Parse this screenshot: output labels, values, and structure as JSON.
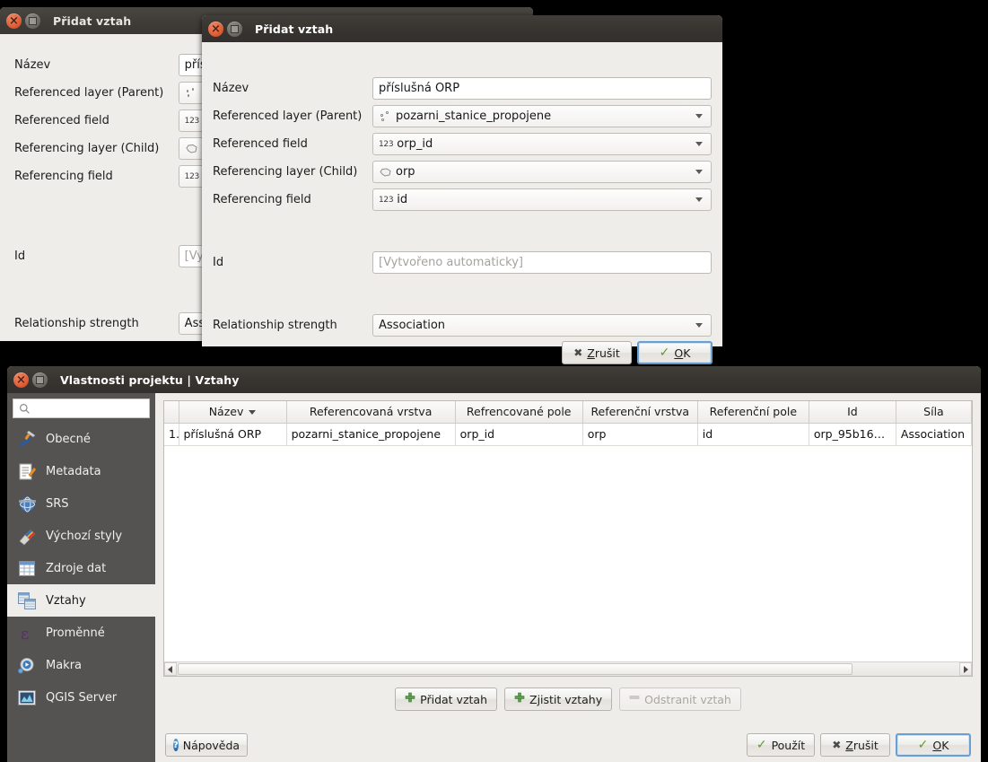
{
  "dialog_back": {
    "title": "Přidat vztah",
    "labels": {
      "name": "Název",
      "referenced_layer": "Referenced layer (Parent)",
      "referenced_field": "Referenced field",
      "referencing_layer": "Referencing layer (Child)",
      "referencing_field": "Referencing field",
      "id": "Id",
      "strength": "Relationship strength"
    },
    "values": {
      "name": "přís",
      "referenced_field_icon": "123",
      "referencing_field_icon": "123",
      "id_placeholder": "[Vy",
      "strength": "Ass"
    }
  },
  "dialog_front": {
    "title": "Přidat vztah",
    "labels": {
      "name": "Název",
      "referenced_layer": "Referenced layer (Parent)",
      "referenced_field": "Referenced field",
      "referencing_layer": "Referencing layer (Child)",
      "referencing_field": "Referencing field",
      "id": "Id",
      "strength": "Relationship strength"
    },
    "values": {
      "name": "příslušná ORP",
      "referenced_layer": "pozarni_stanice_propojene",
      "referenced_field": "orp_id",
      "referencing_layer": "orp",
      "referencing_field": "id",
      "id_placeholder": "[Vytvořeno automaticky]",
      "strength": "Association"
    },
    "field_icon_label": "123",
    "buttons": {
      "cancel": "Zrušit",
      "ok": "OK"
    }
  },
  "properties": {
    "title": "Vlastnosti projektu | Vztahy",
    "search_placeholder": "",
    "sidebar": [
      {
        "label": "Obecné",
        "icon": "hammer-wrench-icon",
        "active": false
      },
      {
        "label": "Metadata",
        "icon": "document-pencil-icon",
        "active": false
      },
      {
        "label": "SRS",
        "icon": "globe-icon",
        "active": false
      },
      {
        "label": "Výchozí styly",
        "icon": "paintbrush-icon",
        "active": false
      },
      {
        "label": "Zdroje dat",
        "icon": "table-icon",
        "active": false
      },
      {
        "label": "Vztahy",
        "icon": "relations-icon",
        "active": true
      },
      {
        "label": "Proměnné",
        "icon": "epsilon-icon",
        "active": false
      },
      {
        "label": "Makra",
        "icon": "gear-play-icon",
        "active": false
      },
      {
        "label": "QGIS Server",
        "icon": "server-image-icon",
        "active": false
      }
    ],
    "table": {
      "headers": [
        "Název",
        "Referencovaná vrstva",
        "Refrencované pole",
        "Referenční vrstva",
        "Referenční pole",
        "Id",
        "Síla"
      ],
      "rows": [
        {
          "num": "1",
          "cells": [
            "příslušná ORP",
            "pozarni_stanice_propojene",
            "orp_id",
            "orp",
            "id",
            "orp_95b16…",
            "Association"
          ]
        }
      ]
    },
    "action_buttons": [
      {
        "label": "Přidat vztah",
        "icon": "plus-icon",
        "enabled": true
      },
      {
        "label": "Zjistit vztahy",
        "icon": "plus-icon",
        "enabled": true
      },
      {
        "label": "Odstranit vztah",
        "icon": "minus-icon",
        "enabled": false
      }
    ],
    "footer_buttons": {
      "help": "Nápověda",
      "apply": "Použít",
      "cancel": "Zrušit",
      "ok": "OK"
    }
  },
  "colors": {
    "titlebar": "#3a3733",
    "dialog_bg": "#efedea",
    "sidebar_bg": "#555351",
    "selection": "#e3f0fb",
    "accent_green": "#5f9a2e",
    "focus_blue": "#6a9fd0"
  }
}
